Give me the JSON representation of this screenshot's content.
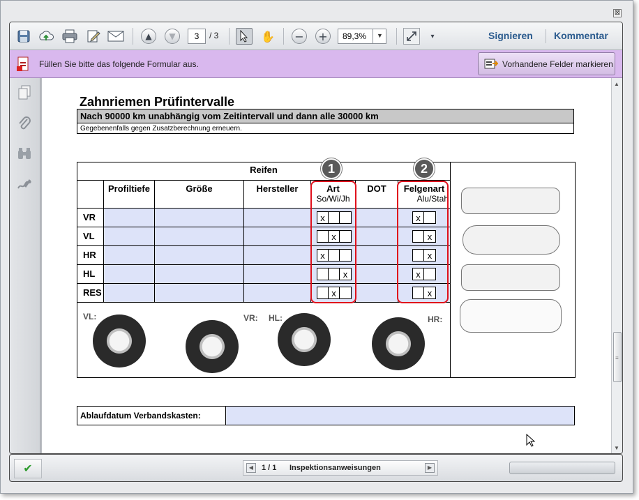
{
  "window": {
    "close_glyph": "⊠"
  },
  "toolbar": {
    "page_current": "3",
    "page_total": "/ 3",
    "zoom": "89,3%",
    "sign_label": "Signieren",
    "comment_label": "Kommentar",
    "icons": [
      "save-icon",
      "cloud-upload-icon",
      "print-icon",
      "edit-icon",
      "email-icon",
      "page-up-icon",
      "page-down-icon",
      "select-tool-icon",
      "hand-tool-icon",
      "zoom-out-icon",
      "zoom-in-icon",
      "fullscreen-icon",
      "more-tools-icon"
    ]
  },
  "formbar": {
    "message": "Füllen Sie bitte das folgende Formular aus.",
    "highlight_button": "Vorhandene Felder markieren"
  },
  "sidebar": {
    "icons": [
      "pages-icon",
      "attachments-icon",
      "binoculars-icon",
      "signatures-icon"
    ]
  },
  "document": {
    "title": "Zahnriemen Prüfintervalle",
    "interval_text": "Nach 90000 km unabhängig vom Zeitintervall und dann alle 30000 km",
    "interval_note": "Gegebenenfalls gegen Zusatzberechnung erneuern.",
    "tires": {
      "heading": "Reifen",
      "columns": [
        "Profiltiefe",
        "Größe",
        "Hersteller",
        "Art",
        "DOT",
        "Felgenart"
      ],
      "art_sub": "So/Wi/Jh",
      "felgen_sub": "Alu/Stah",
      "rows": [
        {
          "label": "VR",
          "art": [
            "x",
            "",
            ""
          ],
          "felgen": [
            "x",
            ""
          ]
        },
        {
          "label": "VL",
          "art": [
            "",
            "x",
            ""
          ],
          "felgen": [
            "",
            "x"
          ]
        },
        {
          "label": "HR",
          "art": [
            "x",
            "",
            ""
          ],
          "felgen": [
            "",
            "x"
          ]
        },
        {
          "label": "HL",
          "art": [
            "",
            "",
            "x"
          ],
          "felgen": [
            "x",
            ""
          ]
        },
        {
          "label": "RES",
          "art": [
            "",
            "x",
            ""
          ],
          "felgen": [
            "",
            "x"
          ]
        }
      ],
      "badges": [
        "1",
        "2"
      ],
      "wheel_labels": [
        "VL:",
        "VR:",
        "HL:",
        "HR:"
      ]
    },
    "first_aid_label": "Ablaufdatum Verbandskasten:"
  },
  "statusbar": {
    "check_glyph": "✔",
    "nav_count": "1 / 1",
    "nav_label": "Inspektionsanweisungen"
  }
}
